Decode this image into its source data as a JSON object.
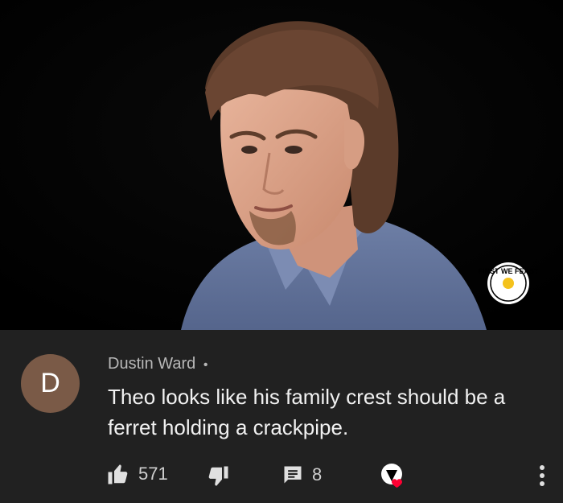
{
  "video": {
    "watermark_icon": "first-we-feast-logo",
    "watermark_text": "FIRST WE FEAST"
  },
  "comment": {
    "avatar_letter": "D",
    "avatar_color": "#7a5a47",
    "author": "Dustin Ward",
    "separator": "•",
    "text": "Theo looks like his family crest should be a ferret holding a crackpipe.",
    "like_count": "571",
    "reply_count": "8",
    "icons": {
      "like": "thumbs-up-icon",
      "dislike": "thumbs-down-icon",
      "replies": "comment-icon",
      "creator_heart": "creator-heart-icon",
      "more": "more-vertical-icon"
    },
    "heart_color": "#ff0033"
  }
}
